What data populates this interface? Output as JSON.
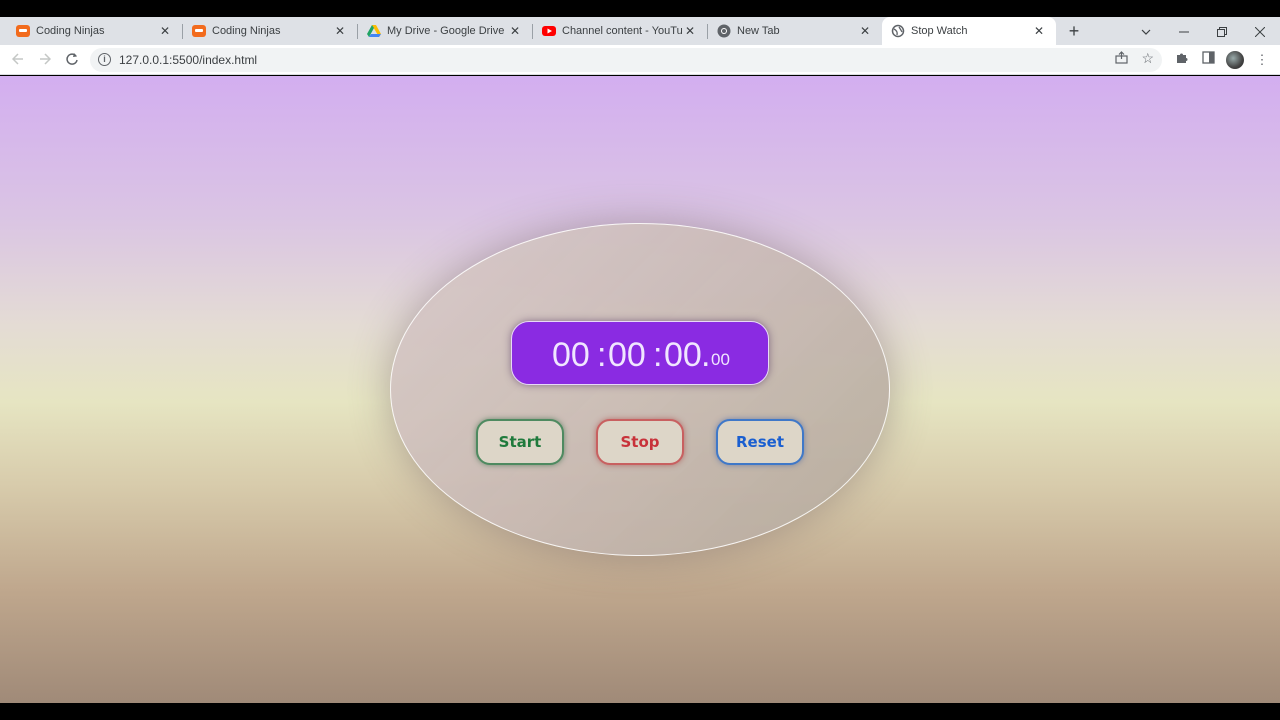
{
  "browser": {
    "tabs": [
      {
        "title": "Coding Ninjas",
        "icon": "coding-ninjas-icon"
      },
      {
        "title": "Coding Ninjas",
        "icon": "coding-ninjas-icon"
      },
      {
        "title": "My Drive - Google Drive",
        "icon": "google-drive-icon"
      },
      {
        "title": "Channel content - YouTube",
        "icon": "youtube-icon"
      },
      {
        "title": "New Tab",
        "icon": "chrome-icon"
      },
      {
        "title": "Stop Watch",
        "icon": "globe-icon",
        "active": true
      }
    ],
    "new_tab": "+",
    "close_glyph": "✕",
    "url": "127.0.0.1:5500/index.html"
  },
  "stopwatch": {
    "hours": "00",
    "minutes": "00",
    "seconds": "00",
    "separator": ":",
    "dot": ".",
    "milliseconds": "00",
    "buttons": {
      "start": "Start",
      "stop": "Stop",
      "reset": "Reset"
    }
  },
  "colors": {
    "display_bg": "#8a2be2",
    "start": "#1f7a3c",
    "stop": "#c8323a",
    "reset": "#1a5fd0"
  }
}
